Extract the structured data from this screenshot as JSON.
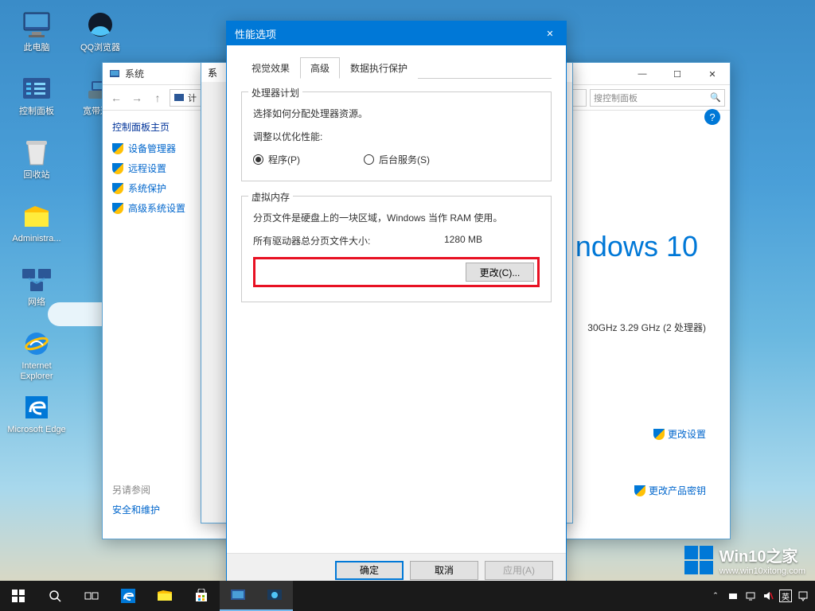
{
  "desktop": {
    "icons": [
      {
        "label": "此电脑",
        "name": "this-pc"
      },
      {
        "label": "QQ浏览器",
        "name": "qq-browser"
      },
      {
        "label": "控制面板",
        "name": "control-panel"
      },
      {
        "label": "宽带连接",
        "name": "broadband"
      },
      {
        "label": "回收站",
        "name": "recycle-bin"
      },
      {
        "label": "Administra...",
        "name": "administrator"
      },
      {
        "label": "网络",
        "name": "network"
      },
      {
        "label": "Internet Explorer",
        "name": "ie"
      },
      {
        "label": "Microsoft Edge",
        "name": "edge"
      }
    ]
  },
  "system_window": {
    "title": "系统",
    "menu": "系统",
    "breadcrumb_prefix": "计",
    "search_placeholder": "搜控制面板",
    "side_head": "控制面板主页",
    "side_links": [
      "设备管理器",
      "远程设置",
      "系统保护",
      "高级系统设置"
    ],
    "logo_text": "ndows 10",
    "cpu_info": "30GHz   3.29 GHz  (2 处理器)",
    "change_settings": "更改设置",
    "change_key": "更改产品密钥",
    "see_also": "另请参阅",
    "see_also_link": "安全和维护"
  },
  "props_window": {
    "title": "系"
  },
  "perf_window": {
    "title": "性能选项",
    "tabs": [
      "视觉效果",
      "高级",
      "数据执行保护"
    ],
    "active_tab": 1,
    "scheduling": {
      "title": "处理器计划",
      "desc": "选择如何分配处理器资源。",
      "optimize": "调整以优化性能:",
      "opt_programs": "程序(P)",
      "opt_services": "后台服务(S)"
    },
    "vmem": {
      "title": "虚拟内存",
      "desc": "分页文件是硬盘上的一块区域，Windows 当作 RAM 使用。",
      "size_label": "所有驱动器总分页文件大小:",
      "size_value": "1280 MB",
      "change": "更改(C)..."
    },
    "buttons": {
      "ok": "确定",
      "cancel": "取消",
      "apply": "应用(A)"
    }
  },
  "watermark": {
    "text": "Win10之家",
    "url": "www.win10xitong.com"
  }
}
